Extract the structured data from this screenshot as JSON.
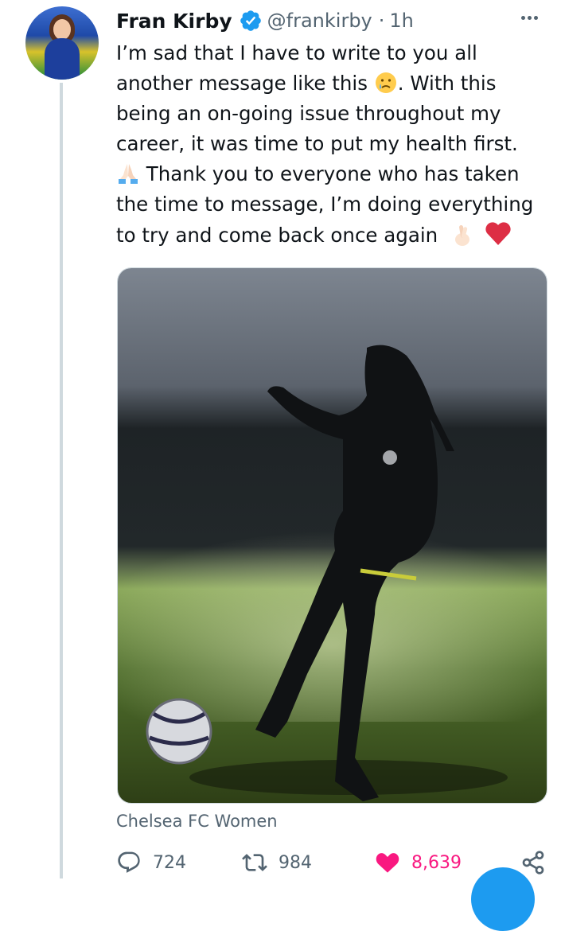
{
  "tweet": {
    "author_name": "Fran Kirby",
    "handle": "@frankirby",
    "separator": "·",
    "time": "1h",
    "lines": [
      "I’m sad that I have to write to you all",
      "another message like this",
      ". With this",
      "being an on-going issue throughout my",
      "career, it was time to put my health first.",
      "Thank you to everyone who has taken",
      "the time to message, I’m doing everything",
      "to try and come back once again"
    ],
    "media_source": "Chelsea FC Women"
  },
  "actions": {
    "replies": "724",
    "retweets": "984",
    "likes": "8,639"
  },
  "colors": {
    "accent": "#1d9bf0",
    "like": "#f91880",
    "muted": "#536471",
    "thread": "#cfd9de"
  },
  "icons": [
    "verified-badge-icon",
    "more-options-icon",
    "crying-face-emoji",
    "praying-hands-emoji",
    "crossed-fingers-emoji",
    "red-heart-emoji",
    "reply-icon",
    "retweet-icon",
    "like-heart-icon",
    "share-icon"
  ]
}
